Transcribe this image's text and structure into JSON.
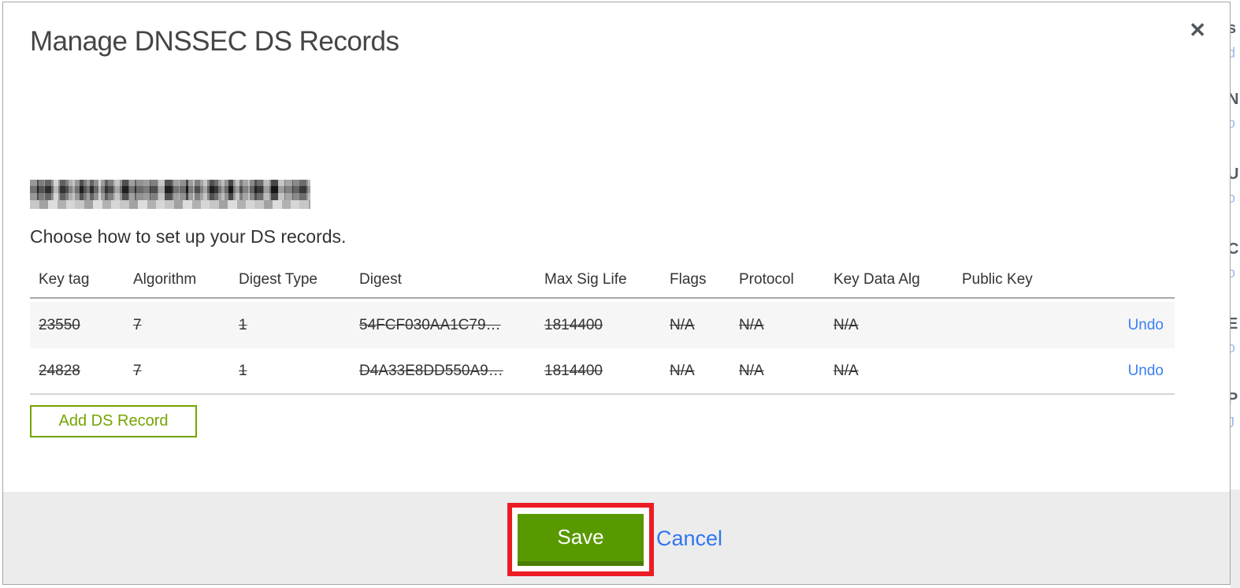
{
  "modal": {
    "title": "Manage DNSSEC DS Records",
    "close_icon": "✕",
    "instruction": "Choose how to set up your DS records.",
    "table": {
      "columns": [
        "Key tag",
        "Algorithm",
        "Digest Type",
        "Digest",
        "Max Sig Life",
        "Flags",
        "Protocol",
        "Key Data Alg",
        "Public Key"
      ],
      "rows": [
        {
          "key_tag": "23550",
          "algorithm": "7",
          "digest_type": "1",
          "digest": "54FCF030AA1C79…",
          "max_sig_life": "1814400",
          "flags": "N/A",
          "protocol": "N/A",
          "key_data_alg": "N/A",
          "public_key": "",
          "action": "Undo",
          "state": "deleted-strikethrough"
        },
        {
          "key_tag": "24828",
          "algorithm": "7",
          "digest_type": "1",
          "digest": "D4A33E8DD550A9…",
          "max_sig_life": "1814400",
          "flags": "N/A",
          "protocol": "N/A",
          "key_data_alg": "N/A",
          "public_key": "",
          "action": "Undo",
          "state": "deleted-strikethrough"
        }
      ]
    },
    "add_button": "Add DS Record",
    "footer": {
      "save": "Save",
      "cancel": "Cancel"
    }
  },
  "annotation": {
    "shape": "red-rectangle-highlight",
    "color": "#ec1c24",
    "target": "save-button"
  },
  "background_fragments": [
    "s",
    "d",
    "N",
    "o",
    "U",
    "o",
    "C",
    "o",
    "E",
    "o",
    "P",
    "J"
  ],
  "colors": {
    "accent_green": "#589900",
    "outline_green": "#74a400",
    "link_blue": "#3b80f2",
    "annotation_red": "#ec1c24",
    "footer_gray": "#ececec",
    "row_stripe_gray": "#f6f6f7"
  }
}
